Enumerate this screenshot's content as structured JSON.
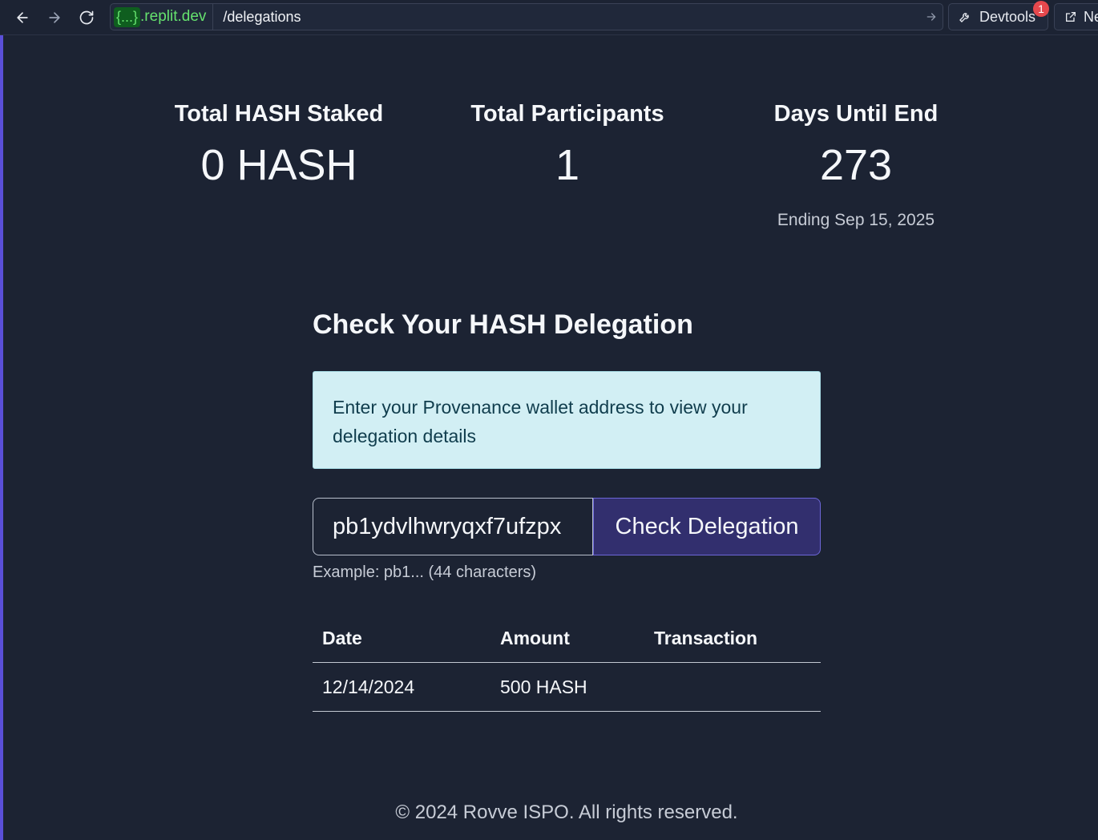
{
  "browser": {
    "host_braces": "{...}",
    "host_domain": ".replit.dev",
    "path": "/delegations",
    "devtools_label": "Devtools",
    "devtools_badge": "1",
    "newtab_label": "Ne"
  },
  "stats": [
    {
      "label": "Total HASH Staked",
      "value": "0 HASH"
    },
    {
      "label": "Total Participants",
      "value": "1"
    },
    {
      "label": "Days Until End",
      "value": "273",
      "sub": "Ending Sep 15, 2025"
    }
  ],
  "check": {
    "title": "Check Your HASH Delegation",
    "info": "Enter your Provenance wallet address to view your delegation details",
    "input_value": "pb1ydvlhwryqxf7ufzpx",
    "button_label": "Check Delegation",
    "hint": "Example: pb1... (44 characters)"
  },
  "table": {
    "headers": [
      "Date",
      "Amount",
      "Transaction"
    ],
    "rows": [
      {
        "date": "12/14/2024",
        "amount": "500 HASH",
        "transaction": ""
      }
    ]
  },
  "footer": "© 2024 Rovve ISPO. All rights reserved.",
  "colors": {
    "background": "#1c2333",
    "info_bg": "#d2eff4",
    "button_bg": "#322f6e",
    "accent": "#5a4fd8"
  }
}
